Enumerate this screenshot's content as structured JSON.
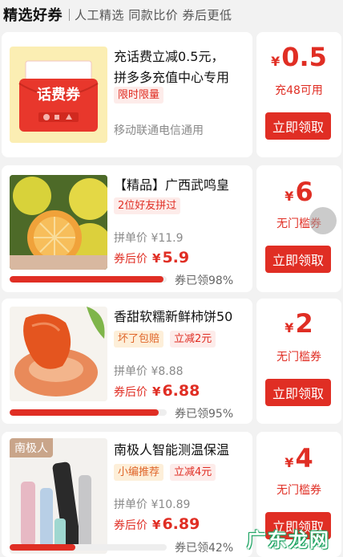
{
  "header": {
    "title": "精选好券",
    "subtitle": "人工精选 同款比价 券后更低"
  },
  "cards": [
    {
      "name": "充话费立减0.5元，",
      "name2": "拼多多充值中心专用",
      "tag": "限时限量",
      "note": "移动联通电信通用",
      "image_caption": "话费券",
      "coupon_currency": "¥",
      "coupon_value": "0.5",
      "coupon_condition": "充48可用",
      "button": "立即领取"
    },
    {
      "name": "【精品】广西武鸣皇",
      "tag": "2位好友拼过",
      "group_price_label": "拼单价 ¥11.9",
      "after_label": "券后价",
      "after_currency": "¥",
      "after_price": "5.9",
      "claimed": "券已领98%",
      "claimed_fraction": 0.98,
      "coupon_currency": "¥",
      "coupon_value": "6",
      "coupon_condition": "无门槛券",
      "button": "立即领取"
    },
    {
      "name": "香甜软糯新鲜柿饼50",
      "tag1": "坏了包赔",
      "tag2": "立减2元",
      "group_price_label": "拼单价 ¥8.88",
      "after_label": "券后价",
      "after_currency": "¥",
      "after_price": "6.88",
      "claimed": "券已领95%",
      "claimed_fraction": 0.95,
      "coupon_currency": "¥",
      "coupon_value": "2",
      "coupon_condition": "无门槛券",
      "button": "立即领取"
    },
    {
      "name": "南极人智能测温保温",
      "tag1": "小编推荐",
      "tag2": "立减4元",
      "group_price_label": "拼单价 ¥10.89",
      "after_label": "券后价",
      "after_currency": "¥",
      "after_price": "6.89",
      "claimed": "券已领42%",
      "claimed_fraction": 0.42,
      "image_label": "南极人",
      "coupon_currency": "¥",
      "coupon_value": "4",
      "coupon_condition": "无门槛券",
      "button": "立即领取"
    }
  ],
  "watermark": [
    "广",
    "东",
    "龙",
    "网"
  ],
  "colors": {
    "accent": "#e02e24",
    "tag_bg": "#fdecea",
    "page_bg": "#f2f2f2"
  }
}
